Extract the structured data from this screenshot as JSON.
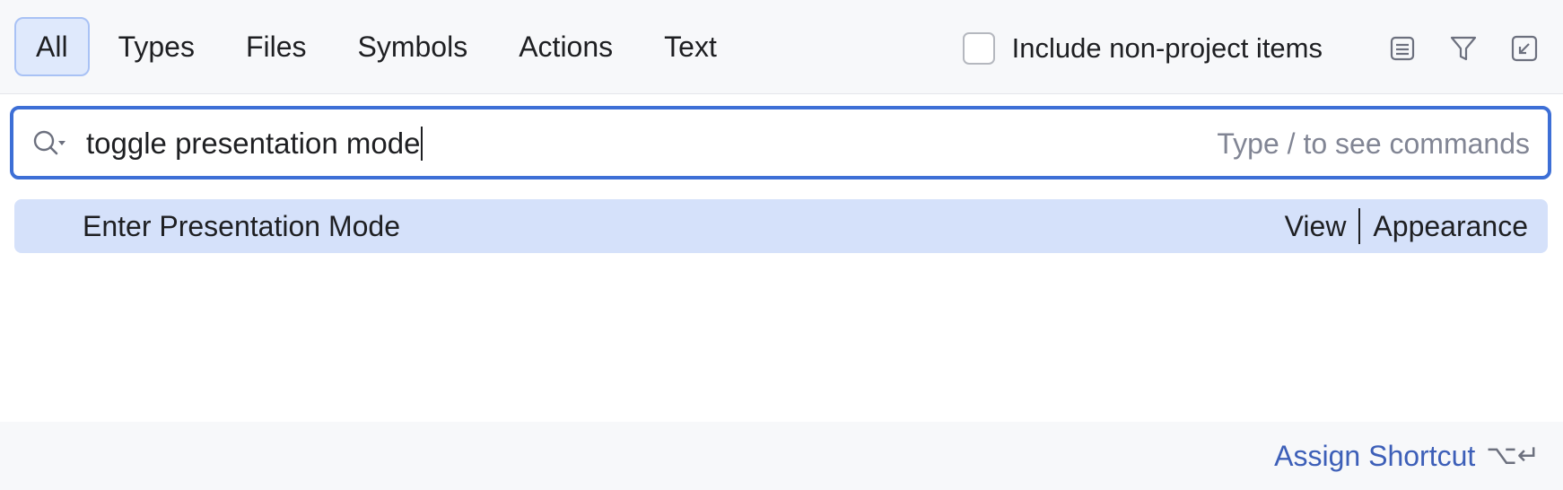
{
  "tabs": [
    {
      "label": "All",
      "active": true
    },
    {
      "label": "Types",
      "active": false
    },
    {
      "label": "Files",
      "active": false
    },
    {
      "label": "Symbols",
      "active": false
    },
    {
      "label": "Actions",
      "active": false
    },
    {
      "label": "Text",
      "active": false
    }
  ],
  "options": {
    "include_non_project_label": "Include non-project items",
    "include_non_project_checked": false,
    "icons": [
      "preview-icon",
      "filter-icon",
      "collapse-icon"
    ]
  },
  "search": {
    "value": "toggle presentation mode",
    "hint": "Type / to see commands"
  },
  "results": [
    {
      "name": "Enter Presentation Mode",
      "location_primary": "View",
      "location_secondary": "Appearance",
      "selected": true
    }
  ],
  "footer": {
    "action_label": "Assign Shortcut",
    "shortcut": "⌥↵"
  },
  "colors": {
    "accent": "#3d6fd6",
    "selection": "#d5e1fa",
    "active_tab_bg": "#dfe9fc",
    "link": "#3d5fb8"
  }
}
